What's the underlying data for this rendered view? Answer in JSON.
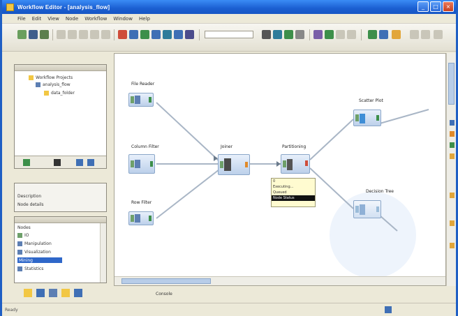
{
  "window": {
    "title": "Workflow Editor - [analysis_flow]",
    "buttons": {
      "minimize": "_",
      "maximize": "□",
      "close": "×"
    }
  },
  "menubar": [
    "File",
    "Edit",
    "View",
    "Node",
    "Workflow",
    "Window",
    "Help"
  ],
  "colors": {
    "titlebar": "#1f5fc4",
    "node_fill": "#bcd0ea",
    "port_in": "#6ea06a",
    "port_out": "#e08a2a",
    "selection": "#2f67c9"
  },
  "repository": {
    "items": [
      "Workflow Projects",
      "analysis_flow",
      "data_folder"
    ]
  },
  "node_panel": {
    "header": "Nodes",
    "items": [
      "IO",
      "Manipulation",
      "Visualization",
      "Mining",
      "Statistics"
    ]
  },
  "description_panel": {
    "lines": [
      "Description",
      "Node details"
    ]
  },
  "canvas": {
    "nodes": [
      {
        "label": "File Reader"
      },
      {
        "label": "Column Filter"
      },
      {
        "label": "Row Filter"
      },
      {
        "label": "Joiner"
      },
      {
        "label": "Partitioning"
      },
      {
        "label": "Scatter Plot"
      },
      {
        "label": "Decision Tree"
      }
    ],
    "tooltip": [
      "0",
      "Executing...",
      "Queued",
      "Node Status"
    ]
  },
  "statusbar": {
    "text": "Ready",
    "bottom_label": "Console"
  }
}
